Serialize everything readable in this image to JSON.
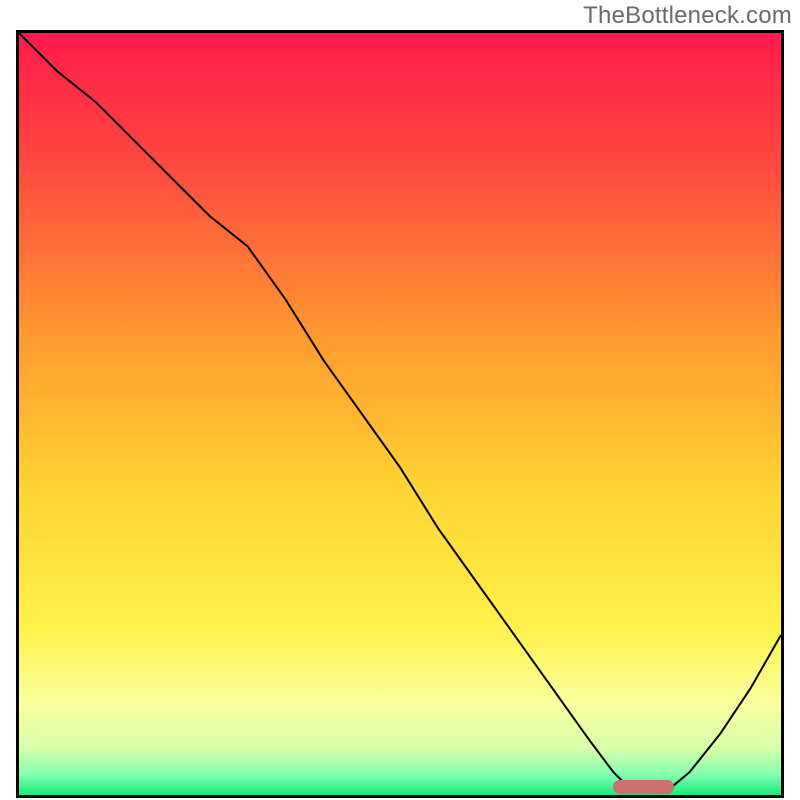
{
  "watermark": "TheBottleneck.com",
  "chart_data": {
    "type": "line",
    "title": "",
    "xlabel": "",
    "ylabel": "",
    "xlim": [
      0,
      100
    ],
    "ylim": [
      0,
      100
    ],
    "grid": false,
    "series": [
      {
        "name": "bottleneck-curve",
        "x": [
          0,
          5,
          10,
          15,
          20,
          25,
          30,
          35,
          40,
          45,
          50,
          55,
          60,
          65,
          70,
          75,
          78,
          80,
          82,
          85,
          88,
          92,
          96,
          100
        ],
        "y": [
          100,
          95,
          91,
          86,
          81,
          76,
          72,
          65,
          57,
          50,
          43,
          35,
          28,
          21,
          14,
          7,
          3,
          1,
          0.5,
          0.5,
          3,
          8,
          14,
          21
        ]
      }
    ],
    "marker": {
      "name": "optimum-range",
      "x_start": 78,
      "x_end": 86,
      "y": 1
    },
    "gradient_stops": [
      {
        "offset": 0,
        "color": "#ff1a4c"
      },
      {
        "offset": 18,
        "color": "#ff4b3f"
      },
      {
        "offset": 40,
        "color": "#ff9a2f"
      },
      {
        "offset": 60,
        "color": "#ffd433"
      },
      {
        "offset": 78,
        "color": "#fff24a"
      },
      {
        "offset": 88,
        "color": "#fbff9e"
      },
      {
        "offset": 94,
        "color": "#d6ffab"
      },
      {
        "offset": 97.5,
        "color": "#7cffb0"
      },
      {
        "offset": 100,
        "color": "#19e877"
      }
    ]
  }
}
